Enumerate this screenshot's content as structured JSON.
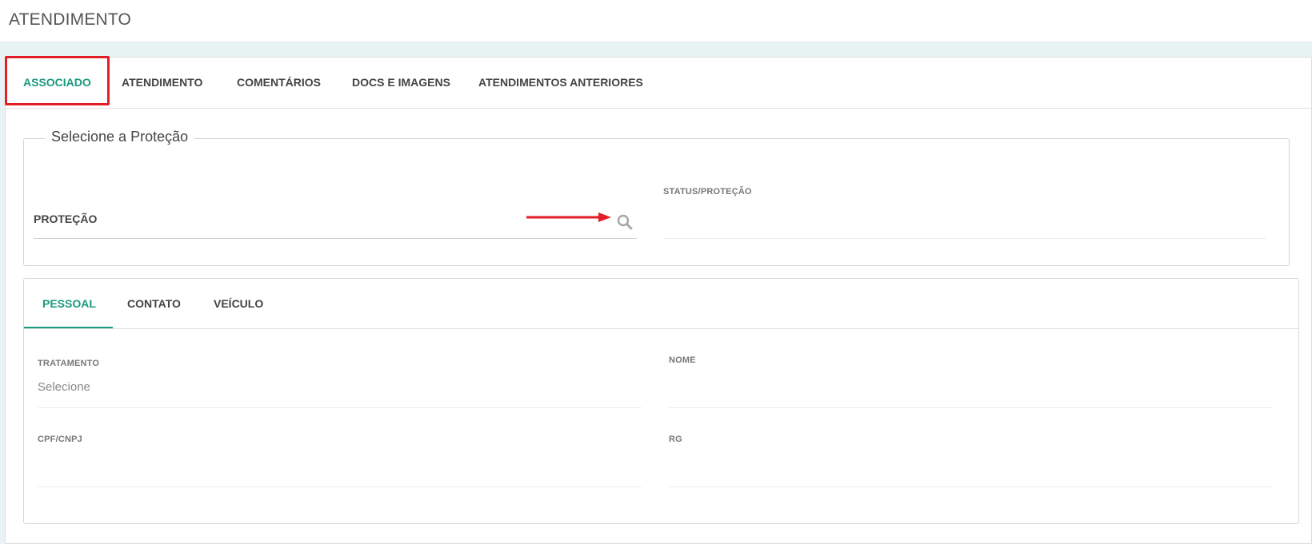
{
  "header": {
    "title": "ATENDIMENTO"
  },
  "tabs": [
    {
      "label": "ASSOCIADO",
      "active": true
    },
    {
      "label": "ATENDIMENTO",
      "active": false
    },
    {
      "label": "COMENTÁRIOS",
      "active": false
    },
    {
      "label": "DOCS E IMAGENS",
      "active": false
    },
    {
      "label": "ATENDIMENTOS ANTERIORES",
      "active": false
    }
  ],
  "protecao_section": {
    "legend": "Selecione a Proteção",
    "protecao_label": "PROTEÇÃO",
    "search_icon": "search-icon",
    "status_label": "STATUS/PROTEÇÃO"
  },
  "sub_tabs": [
    {
      "label": "PESSOAL",
      "active": true
    },
    {
      "label": "CONTATO",
      "active": false
    },
    {
      "label": "VEÍCULO",
      "active": false
    }
  ],
  "pessoal": {
    "tratamento_label": "TRATAMENTO",
    "tratamento_value": "Selecione",
    "nome_label": "NOME",
    "cpf_label": "CPF/CNPJ",
    "rg_label": "RG"
  },
  "colors": {
    "accent": "#1a9a7e",
    "highlight": "#e41e26"
  }
}
